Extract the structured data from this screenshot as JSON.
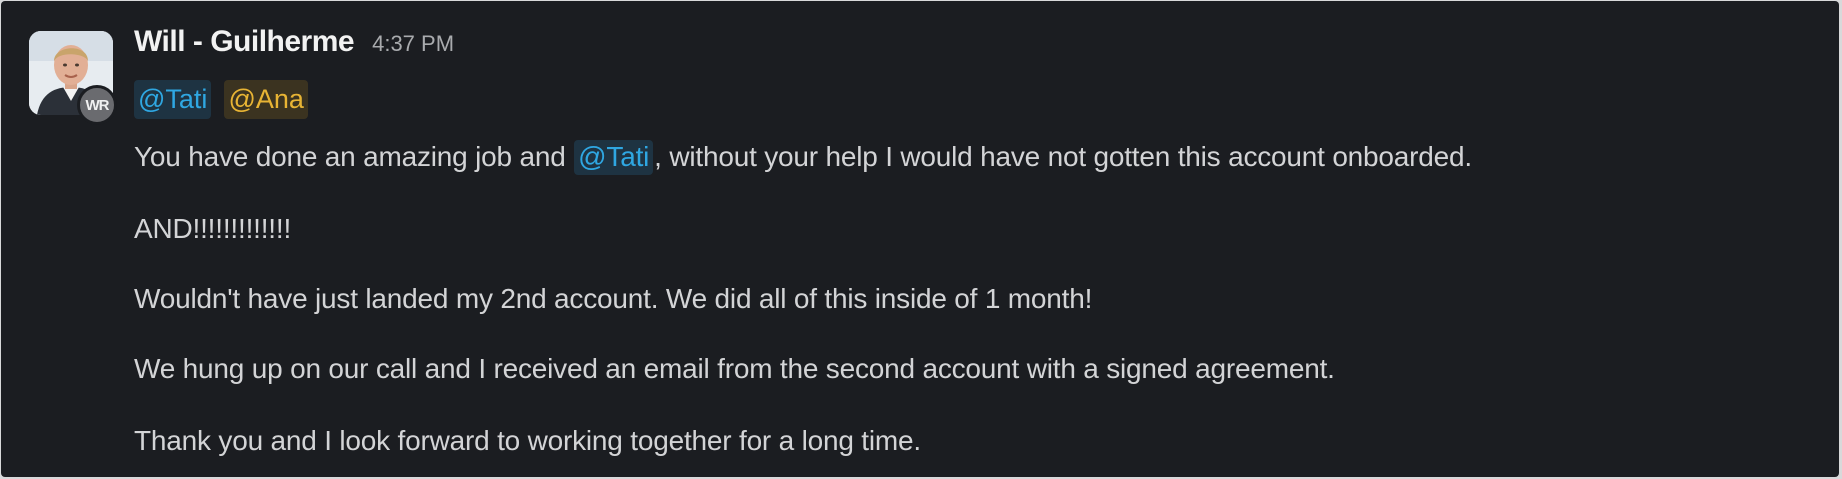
{
  "message": {
    "sender": "Will - Guilherme",
    "timestamp": "4:37 PM",
    "avatar_badge": "WR",
    "mentions": [
      "@Tati",
      "@Ana"
    ],
    "lines": {
      "l1_before": "You have done an amazing job and ",
      "l1_mention": "@Tati",
      "l1_after": ", without your help I would have not gotten this account onboarded.",
      "l2": "AND!!!!!!!!!!!!!",
      "l3": "Wouldn't have just landed my 2nd account. We did all of this inside of 1 month!",
      "l4": "We hung up on our call and I received an email from the second account with a signed agreement.",
      "l5": "Thank you and I look forward to working together for a long time."
    }
  },
  "colors": {
    "background": "#1b1d21",
    "text": "#d3d4d6",
    "mention_blue": "#2fa7e2",
    "mention_yellow": "#e8b434"
  }
}
